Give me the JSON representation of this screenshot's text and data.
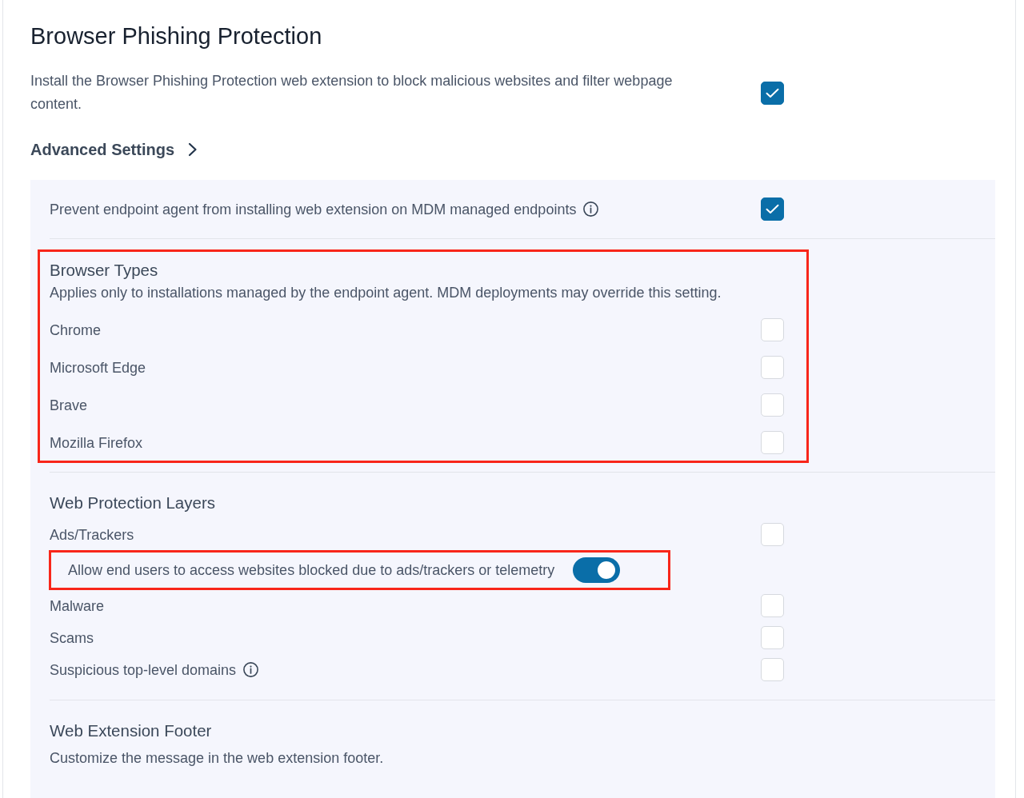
{
  "header": {
    "title": "Browser Phishing Protection",
    "description": "Install the Browser Phishing Protection web extension to block malicious websites and filter webpage content.",
    "checked": true
  },
  "advanced_settings": {
    "label": "Advanced Settings"
  },
  "panel": {
    "top_option": {
      "label": "Prevent endpoint agent from installing web extension on MDM managed endpoints",
      "info": true,
      "checked": true
    },
    "sections": [
      {
        "title": "Browser Types",
        "description": "Applies only to installations managed by the endpoint agent. MDM deployments may override this setting.",
        "highlighted": true,
        "options": [
          {
            "kind": "checkbox",
            "label": "Chrome",
            "checked": false
          },
          {
            "kind": "checkbox",
            "label": "Microsoft Edge",
            "checked": false
          },
          {
            "kind": "checkbox",
            "label": "Brave",
            "checked": false
          },
          {
            "kind": "checkbox",
            "label": "Mozilla Firefox",
            "checked": false
          }
        ]
      },
      {
        "title": "Web Protection Layers",
        "options": [
          {
            "kind": "checkbox",
            "label": "Ads/Trackers",
            "checked": false
          },
          {
            "kind": "toggle",
            "label": "Allow end users to access websites blocked due to ads/trackers or telemetry",
            "on": true,
            "highlighted": true
          },
          {
            "kind": "checkbox",
            "label": "Malware",
            "checked": false
          },
          {
            "kind": "checkbox",
            "label": "Scams",
            "checked": false
          },
          {
            "kind": "checkbox",
            "label": "Suspicious top-level domains",
            "info": true,
            "checked": false
          }
        ]
      },
      {
        "title": "Web Extension Footer",
        "description": "Customize the message in the web extension footer."
      }
    ]
  }
}
